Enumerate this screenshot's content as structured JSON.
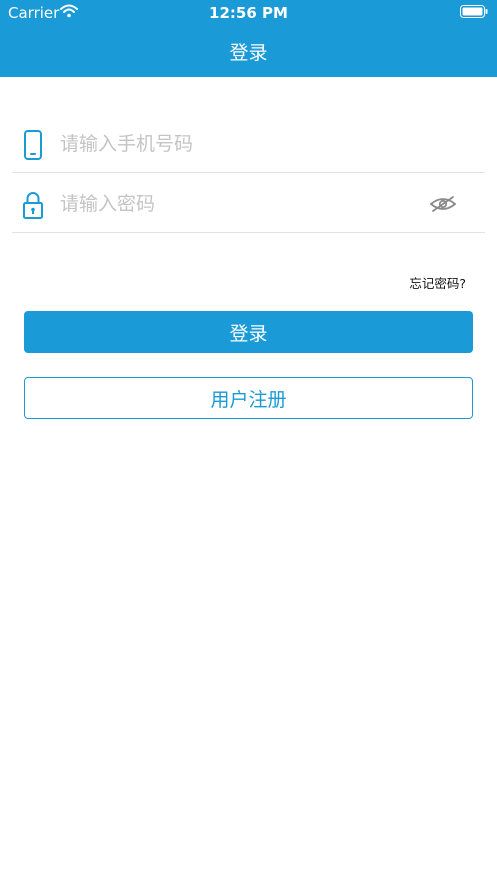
{
  "status_bar": {
    "carrier": "Carrier",
    "time": "12:56 PM"
  },
  "header": {
    "title": "登录"
  },
  "form": {
    "phone_placeholder": "请输入手机号码",
    "password_placeholder": "请输入密码",
    "phone_icon": "phone-icon",
    "lock_icon": "lock-icon",
    "visibility_icon": "eye-icon",
    "forgot_label": "忘记密码?"
  },
  "buttons": {
    "login_label": "登录",
    "register_label": "用户注册"
  },
  "colors": {
    "accent": "#1a9ad6",
    "placeholder": "#c4c4c4",
    "divider": "#e2e2e2"
  }
}
